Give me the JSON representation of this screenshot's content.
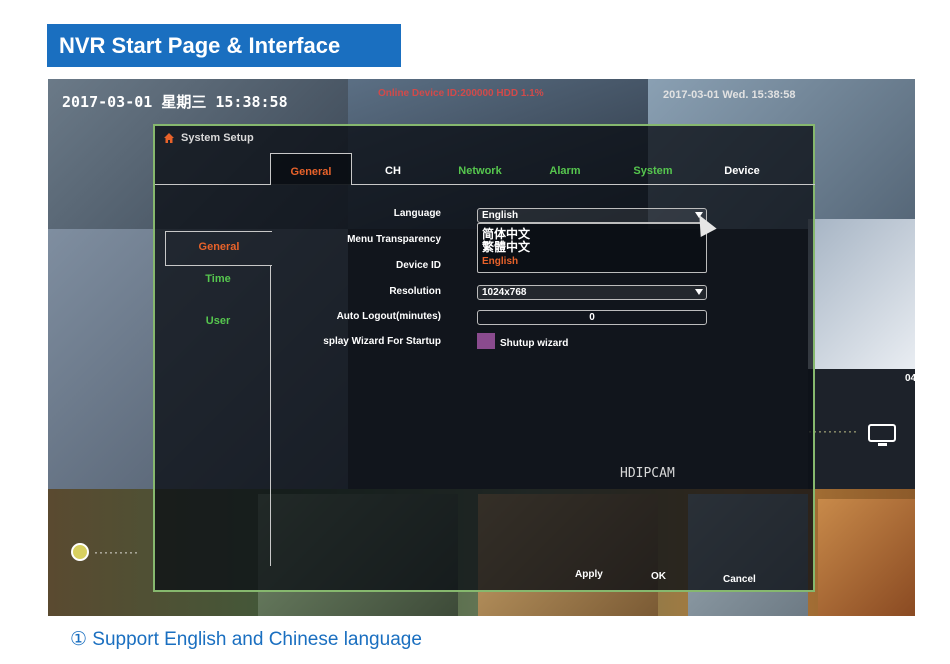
{
  "banner": {
    "title": "NVR Start Page & Interface"
  },
  "osd": {
    "datetime": "2017-03-01 星期三 15:38:58",
    "online_device": "Online Device ID:200000 HDD 1.1%",
    "datetime_right": "2017-03-01 Wed. 15:38:58",
    "hdipcam": "HDIPCAM",
    "right_code": "04"
  },
  "dialog": {
    "title": "System Setup",
    "tabs": [
      {
        "label": "General",
        "active": true
      },
      {
        "label": "CH"
      },
      {
        "label": "Network"
      },
      {
        "label": "Alarm"
      },
      {
        "label": "System"
      },
      {
        "label": "Device"
      }
    ],
    "sidebar": [
      {
        "label": "General",
        "active": true
      },
      {
        "label": "Time"
      },
      {
        "label": "User"
      }
    ],
    "fields": {
      "language": {
        "label": "Language",
        "value": "English"
      },
      "menu_transparency": {
        "label": "Menu Transparency"
      },
      "device_id": {
        "label": "Device ID"
      },
      "resolution": {
        "label": "Resolution",
        "value": "1024x768"
      },
      "auto_logout": {
        "label": "Auto Logout(minutes)",
        "value": "0"
      },
      "wizard": {
        "label": "splay Wizard For Startup",
        "checkbox_label": "Shutup wizard"
      }
    },
    "language_options": [
      "简体中文",
      "繁體中文",
      "English"
    ],
    "buttons": {
      "apply": "Apply",
      "ok": "OK",
      "cancel": "Cancel"
    }
  },
  "caption": "① Support English and Chinese language",
  "colors": {
    "accent_orange": "#e8622a",
    "green": "#56c64e",
    "banner_blue": "#1a6fc0"
  }
}
